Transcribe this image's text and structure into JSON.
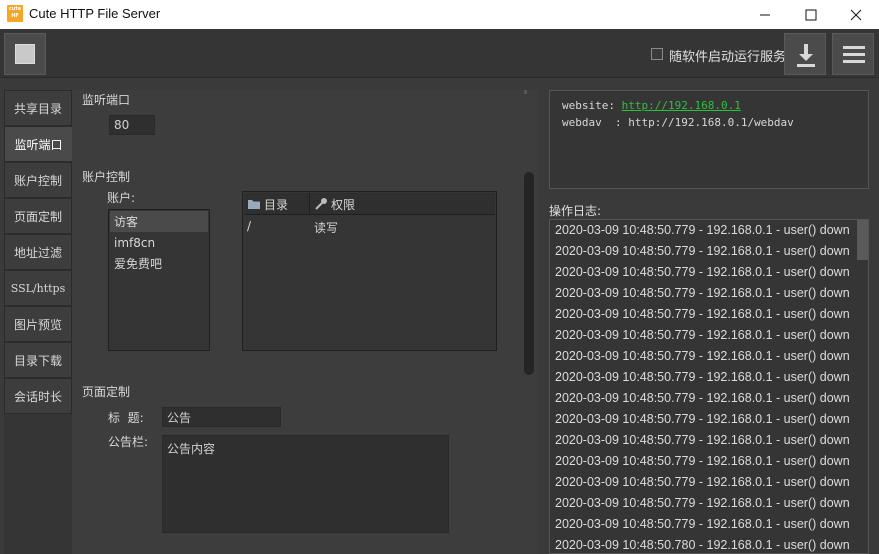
{
  "window": {
    "title": "Cute HTTP File Server",
    "logo_text": [
      "cute",
      "HF"
    ],
    "minimize": "–",
    "maximize": "☐",
    "close": "✕"
  },
  "toolbar": {
    "autostart_label": "随软件启动运行服务",
    "autostart_checked": false
  },
  "nav": {
    "items": [
      {
        "label": "共享目录"
      },
      {
        "label": "监听端口",
        "active": true
      },
      {
        "label": "账户控制"
      },
      {
        "label": "页面定制"
      },
      {
        "label": "地址过滤"
      },
      {
        "label": "SSL/https"
      },
      {
        "label": "图片预览"
      },
      {
        "label": "目录下载"
      },
      {
        "label": "会话时长"
      }
    ]
  },
  "settings": {
    "port": {
      "title": "监听端口",
      "value": "80"
    },
    "account": {
      "title": "账户控制",
      "users_label": "账户:",
      "users": [
        "访客",
        "imf8cn",
        "爱免费吧"
      ],
      "perm_headers": [
        "目录",
        "权限"
      ],
      "perm_rows": [
        {
          "dir": "/",
          "perm": "读写"
        }
      ]
    },
    "page": {
      "title": "页面定制",
      "heading_label": "标  题:",
      "heading_value": "公告",
      "notice_label": "公告栏:",
      "notice_value": "公告内容"
    }
  },
  "urls": {
    "website_label": "website: ",
    "website_url": "http://192.168.0.1",
    "webdav_label": "webdav  : ",
    "webdav_url": "http://192.168.0.1/webdav"
  },
  "log": {
    "title": "操作日志:",
    "lines": [
      "2020-03-09 10:48:50.779 - 192.168.0.1 - user() down",
      "2020-03-09 10:48:50.779 - 192.168.0.1 - user() down",
      "2020-03-09 10:48:50.779 - 192.168.0.1 - user() down",
      "2020-03-09 10:48:50.779 - 192.168.0.1 - user() down",
      "2020-03-09 10:48:50.779 - 192.168.0.1 - user() down",
      "2020-03-09 10:48:50.779 - 192.168.0.1 - user() down",
      "2020-03-09 10:48:50.779 - 192.168.0.1 - user() down",
      "2020-03-09 10:48:50.779 - 192.168.0.1 - user() down",
      "2020-03-09 10:48:50.779 - 192.168.0.1 - user() down",
      "2020-03-09 10:48:50.779 - 192.168.0.1 - user() down",
      "2020-03-09 10:48:50.779 - 192.168.0.1 - user() down",
      "2020-03-09 10:48:50.779 - 192.168.0.1 - user() down",
      "2020-03-09 10:48:50.779 - 192.168.0.1 - user() down",
      "2020-03-09 10:48:50.779 - 192.168.0.1 - user() down",
      "2020-03-09 10:48:50.779 - 192.168.0.1 - user() down",
      "2020-03-09 10:48:50.780 - 192.168.0.1 - user() down"
    ]
  },
  "colors": {
    "link": "#2fbf3f",
    "logo": "#f5a623"
  }
}
